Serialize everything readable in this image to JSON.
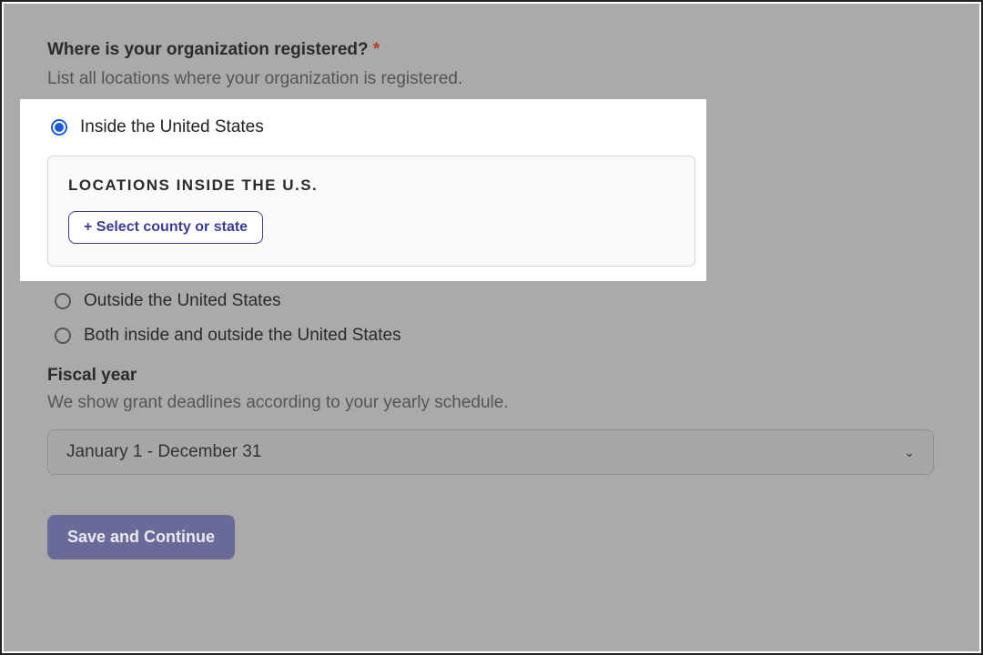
{
  "question": {
    "label": "Where is your organization registered?",
    "required_marker": "*",
    "help": "List all locations where your organization is registered."
  },
  "radios": {
    "inside": "Inside the United States",
    "outside": "Outside the United States",
    "both": "Both inside and outside the United States"
  },
  "locations_panel": {
    "title": "LOCATIONS INSIDE THE U.S.",
    "button": "+ Select county or state"
  },
  "fiscal": {
    "label": "Fiscal year",
    "help": "We show grant deadlines according to your yearly schedule.",
    "selected": "January 1 - December 31"
  },
  "actions": {
    "save": "Save and Continue"
  }
}
